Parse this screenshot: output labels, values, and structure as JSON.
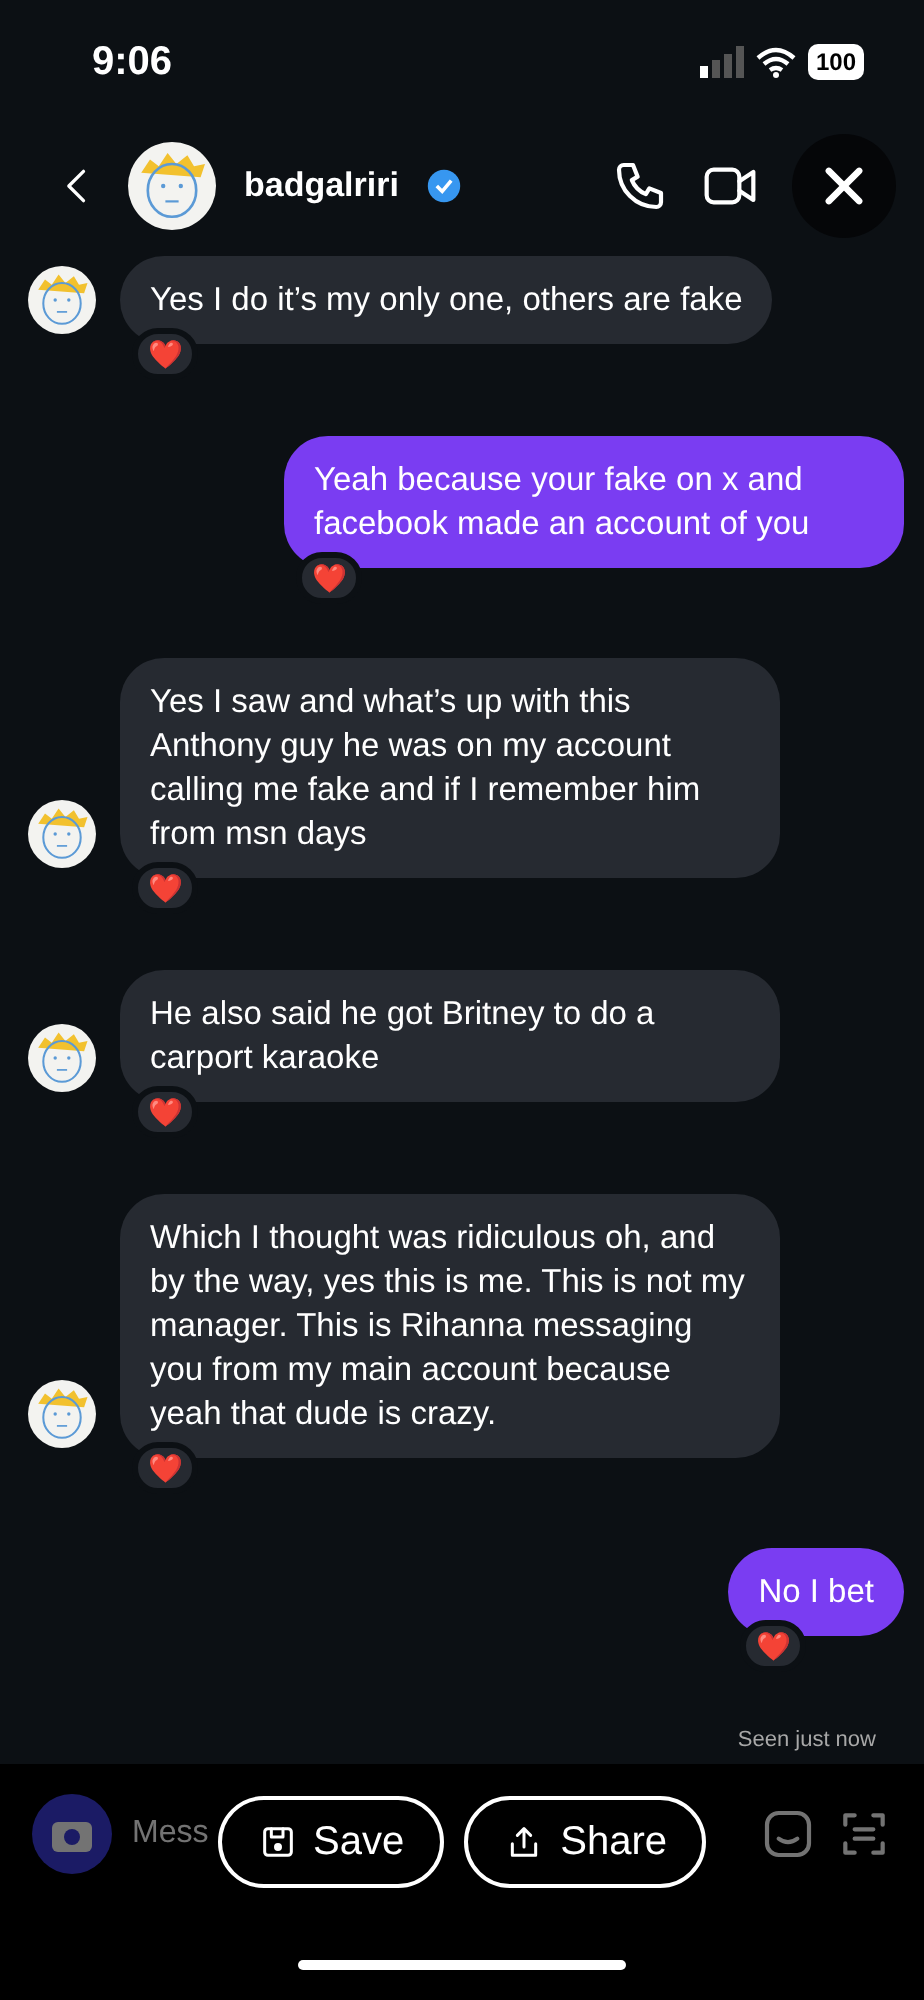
{
  "status_bar": {
    "time": "9:06",
    "battery": "100"
  },
  "header": {
    "username": "badgalriri",
    "verified": true
  },
  "messages": [
    {
      "kind": "incoming",
      "text": "Yes I do it’s my only one, others are fake",
      "reaction": "❤️"
    },
    {
      "kind": "outgoing",
      "text": "Yeah because your fake on x and facebook made an account of you",
      "reaction": "❤️"
    },
    {
      "kind": "incoming",
      "text": "Yes I saw and what’s up with this Anthony guy he was on my account calling me fake and if I remember him from msn days",
      "reaction": "❤️"
    },
    {
      "kind": "incoming",
      "text": "He also said he got Britney to do a carport karaoke",
      "reaction": "❤️"
    },
    {
      "kind": "incoming",
      "text": "Which I thought was ridiculous oh, and by the way, yes this is me. This is not my manager. This is Rihanna messaging you from my main account because yeah that dude is crazy.",
      "reaction": "❤️"
    },
    {
      "kind": "outgoing",
      "text": "No I bet",
      "reaction": "❤️"
    }
  ],
  "seen": "Seen just now",
  "composer": {
    "placeholder": "Mess"
  },
  "actions": [
    {
      "kind": "save",
      "label": "Save"
    },
    {
      "kind": "share",
      "label": "Share"
    }
  ]
}
